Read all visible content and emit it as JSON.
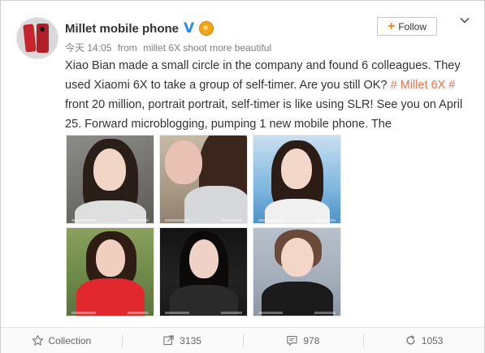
{
  "post": {
    "username": "Millet mobile phone",
    "verified_icon": "verified-v-icon",
    "badge_icon": "medal-icon",
    "time": "今天 14:05",
    "source_prefix": "from",
    "source": "millet 6X shoot more beautiful",
    "text_before": "Xiao Bian made a small circle in the company and found 6 colleagues. They used Xiaomi 6X to take a group of self-timer. Are you still OK? ",
    "topic": "# Millet 6X #",
    "text_after": " front 20 million, portrait portrait, self-timer is like using SLR! See you on April 25. Forward microblogging, pumping 1 new mobile phone. The",
    "verified_glyph": "V"
  },
  "follow": {
    "plus": "+",
    "label": "Follow"
  },
  "photos": [
    {
      "icon": "portrait-photo-1"
    },
    {
      "icon": "portrait-photo-2"
    },
    {
      "icon": "portrait-photo-3"
    },
    {
      "icon": "portrait-photo-4"
    },
    {
      "icon": "portrait-photo-5"
    },
    {
      "icon": "portrait-photo-6"
    }
  ],
  "actions": {
    "collection": {
      "label": "Collection",
      "icon": "star-icon"
    },
    "forward": {
      "count": "3135",
      "icon": "share-icon"
    },
    "comment": {
      "count": "978",
      "icon": "comment-icon"
    },
    "like": {
      "count": "1053",
      "icon": "refresh-icon"
    }
  },
  "colors": {
    "topic": "#eb7350",
    "follow_plus": "#ff8200",
    "verified": "#2d8ee8"
  }
}
